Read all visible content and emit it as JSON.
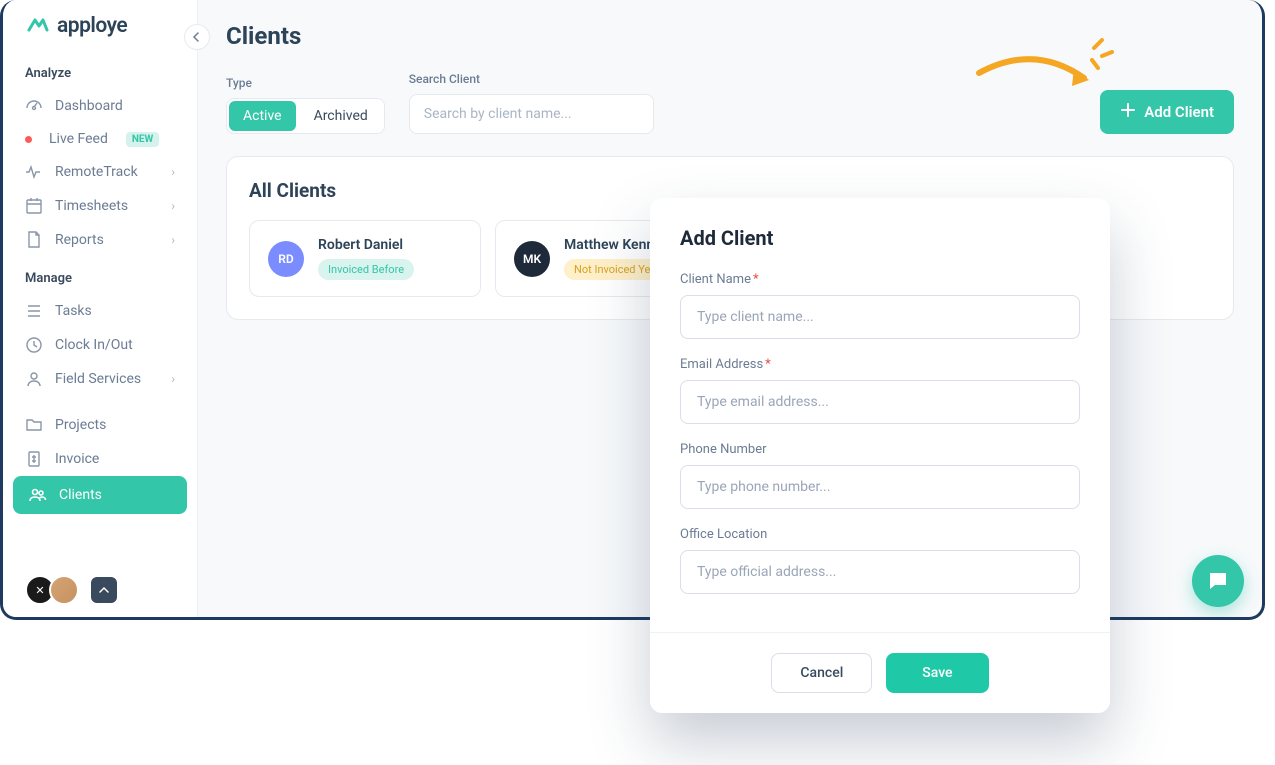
{
  "brand": "apploye",
  "page": {
    "title": "Clients"
  },
  "sidebar": {
    "sections": {
      "analyze": {
        "title": "Analyze",
        "items": {
          "dashboard": "Dashboard",
          "livefeed": "Live Feed",
          "livefeed_badge": "NEW",
          "remotetrack": "RemoteTrack",
          "timesheets": "Timesheets",
          "reports": "Reports"
        }
      },
      "manage": {
        "title": "Manage",
        "items": {
          "tasks": "Tasks",
          "clock": "Clock In/Out",
          "field": "Field Services",
          "projects": "Projects",
          "invoice": "Invoice",
          "clients": "Clients"
        }
      }
    }
  },
  "filters": {
    "type_label": "Type",
    "active": "Active",
    "archived": "Archived",
    "search_label": "Search Client",
    "search_placeholder": "Search by client name..."
  },
  "actions": {
    "add_client": "Add Client"
  },
  "panel": {
    "title": "All Clients",
    "clients": [
      {
        "initials": "RD",
        "name": "Robert Daniel",
        "status": "Invoiced Before",
        "avatar_bg": "#7a8cff",
        "status_bg": "#d9f3ee",
        "status_color": "#33c6a9"
      },
      {
        "initials": "MK",
        "name": "Matthew Kennedy",
        "status": "Not Invoiced Yet",
        "avatar_bg": "#1e2a3a",
        "status_bg": "#fff0c9",
        "status_color": "#d6a321"
      }
    ]
  },
  "modal": {
    "title": "Add Client",
    "fields": {
      "name": {
        "label": "Client Name",
        "placeholder": "Type client name...",
        "required": true
      },
      "email": {
        "label": "Email Address",
        "placeholder": "Type email address...",
        "required": true
      },
      "phone": {
        "label": "Phone Number",
        "placeholder": "Type phone number...",
        "required": false
      },
      "office": {
        "label": "Office Location",
        "placeholder": "Type official address...",
        "required": false
      }
    },
    "cancel": "Cancel",
    "save": "Save"
  }
}
